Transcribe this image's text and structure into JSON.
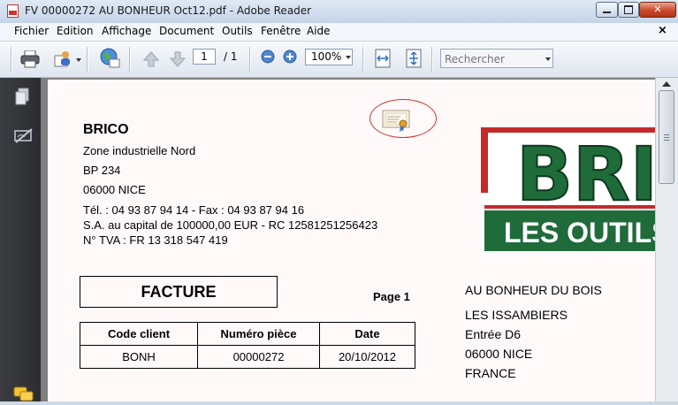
{
  "window": {
    "title": "FV 00000272 AU BONHEUR Oct12.pdf - Adobe Reader",
    "close_glyph": "✕"
  },
  "menu": {
    "items": [
      "Fichier",
      "Edition",
      "Affichage",
      "Document",
      "Outils",
      "Fenêtre",
      "Aide"
    ],
    "close_glyph": "×"
  },
  "toolbar": {
    "page_current": "1",
    "page_total": "/ 1",
    "zoom": "100%",
    "search_placeholder": "Rechercher",
    "icons": [
      "printer-icon",
      "collaborate-icon",
      "globe-icon",
      "previous-page-icon",
      "next-page-icon",
      "zoom-out-icon",
      "zoom-in-icon",
      "fit-width-icon",
      "fit-page-icon"
    ]
  },
  "navpane": {
    "icons": [
      "pages-icon",
      "signatures-icon",
      "comments-icon"
    ]
  },
  "document": {
    "sender": {
      "name": "BRICO",
      "address_lines": [
        "Zone industrielle Nord",
        "BP 234",
        "06000 NICE"
      ],
      "contact_lines": [
        "Tél. : 04 93 87 94 14 - Fax : 04 93 87 94 16",
        "S.A. au capital de 100000,00 EUR - RC 12581251256423",
        "N° TVA : FR 13 318 547 419"
      ]
    },
    "logo": {
      "top_text": "BRI",
      "bottom_text": "LES OUTILS",
      "colors": {
        "green": "#1f6b3a",
        "red": "#c42a2a"
      }
    },
    "title": "FACTURE",
    "page_label": "Page  1",
    "recipient_lines": [
      "AU BONHEUR DU BOIS",
      "LES ISSAMBIERS",
      "Entrée D6",
      "06000 NICE",
      "FRANCE"
    ],
    "info_table": {
      "headers": [
        "Code client",
        "Numéro pièce",
        "Date"
      ],
      "row": [
        "BONH",
        "00000272",
        "20/10/2012"
      ]
    }
  }
}
